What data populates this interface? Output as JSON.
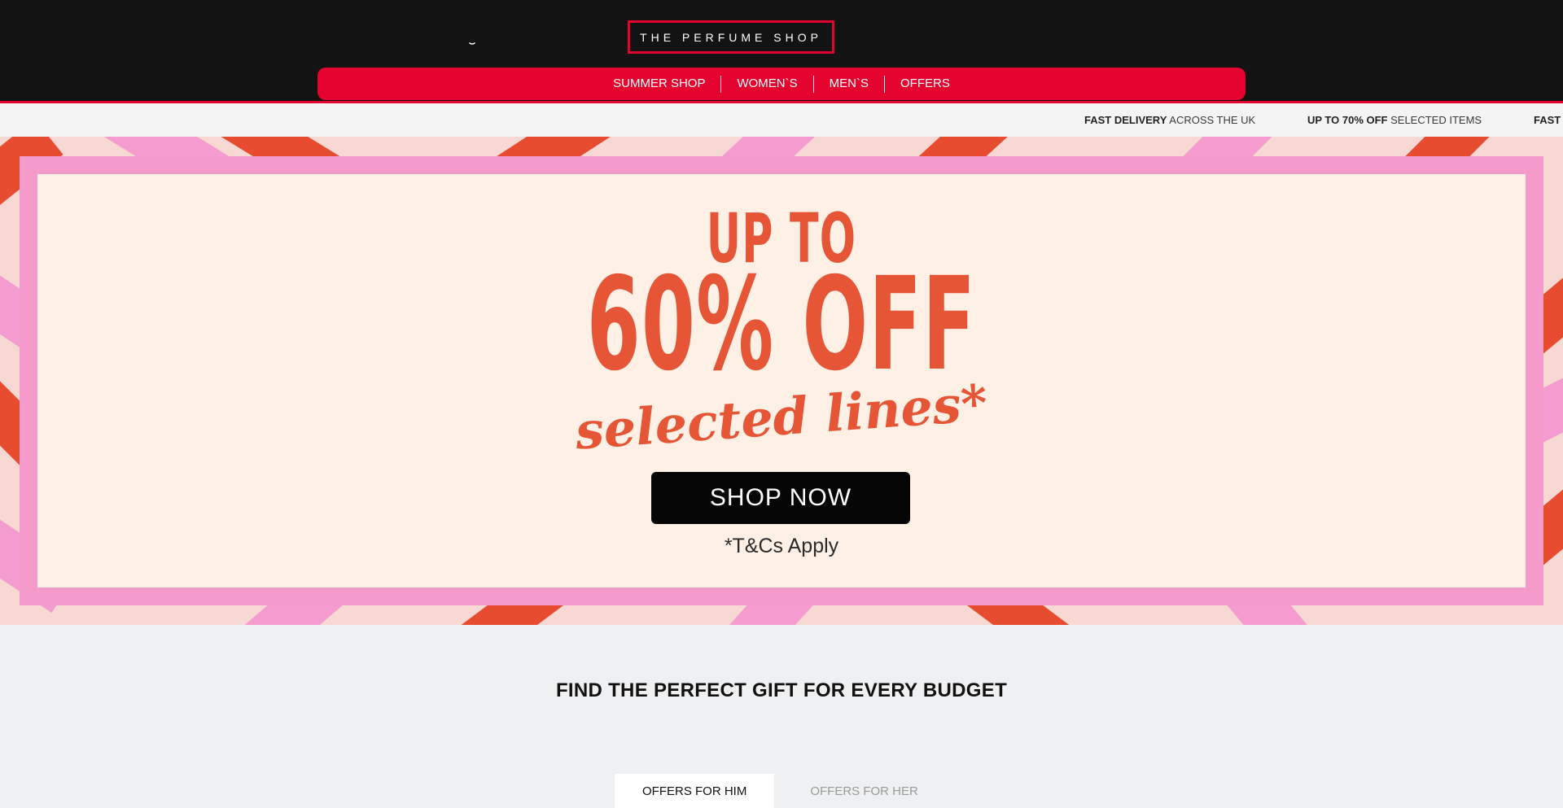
{
  "header": {
    "logo_text": "THE PERFUME SHOP",
    "nav": [
      {
        "label": "SUMMER SHOP"
      },
      {
        "label": "WOMEN`S"
      },
      {
        "label": "MEN`S"
      },
      {
        "label": "OFFERS"
      }
    ]
  },
  "usp": [
    {
      "bold": "FAST DELIVERY",
      "text": " ACROSS THE UK"
    },
    {
      "bold": "UP TO 70% OFF",
      "text": " SELECTED ITEMS"
    },
    {
      "bold": "FAST",
      "text": ""
    }
  ],
  "hero": {
    "line1": "UP TO",
    "line2": "60% OFF",
    "line3": "selected lines*",
    "button": "SHOP NOW",
    "terms": "*T&Cs Apply"
  },
  "gift": {
    "title": "FIND THE PERFECT GIFT FOR EVERY BUDGET",
    "tabs": [
      {
        "label": "OFFERS FOR HIM",
        "active": true
      },
      {
        "label": "OFFERS FOR HER",
        "active": false
      }
    ]
  },
  "colors": {
    "brand_red": "#e4032e",
    "header_bg": "#131313",
    "hero_text": "#e65636",
    "hero_pink": "#f39acb",
    "hero_cream": "#fff0e6"
  }
}
